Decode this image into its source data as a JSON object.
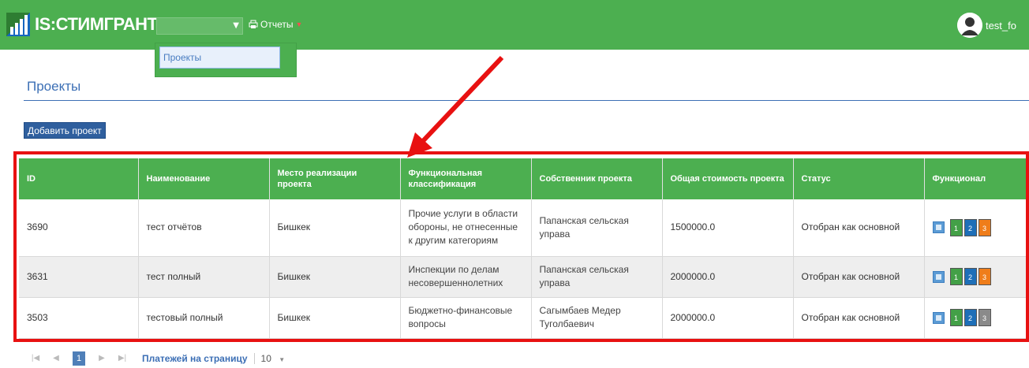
{
  "header": {
    "brand": "IS:СТИМГРАНТ",
    "reports_label": "Отчеты",
    "username": "test_fo",
    "colors": {
      "navbar": "#4caf50",
      "accent": "#3c6fb5"
    }
  },
  "dropdown": {
    "items": [
      {
        "label": "Проекты"
      }
    ]
  },
  "page": {
    "title": "Проекты",
    "add_button": "Добавить проект"
  },
  "table": {
    "columns": [
      "ID",
      "Наименование",
      "Место реализации проекта",
      "Функциональная классификация",
      "Собственник проекта",
      "Общая стоимость проекта",
      "Статус",
      "Функционал"
    ],
    "rows": [
      {
        "id": "3690",
        "name": "тест отчётов",
        "place": "Бишкек",
        "classification": "Прочие услуги в области обороны, не отнесенные к другим категориям",
        "owner": "Папанская сельская управа",
        "cost": "1500000.0",
        "status": "Отобран как основной",
        "docs": [
          "1",
          "2",
          "3"
        ]
      },
      {
        "id": "3631",
        "name": "тест полный",
        "place": "Бишкек",
        "classification": "Инспекции по делам несовершеннолетних",
        "owner": "Папанская сельская управа",
        "cost": "2000000.0",
        "status": "Отобран как основной",
        "docs": [
          "1",
          "2",
          "3"
        ]
      },
      {
        "id": "3503",
        "name": "тестовый полный",
        "place": "Бишкек",
        "classification": "Бюджетно-финансовые вопросы",
        "owner": "Сагымбаев Медер Туголбаевич",
        "cost": "2000000.0",
        "status": "Отобран как основной",
        "docs": [
          "1",
          "2",
          "3"
        ]
      }
    ],
    "doc_colors": {
      "r0": [
        "#43a047",
        "#1e6fb8",
        "#ef7d1a"
      ],
      "r1": [
        "#43a047",
        "#1e6fb8",
        "#ef7d1a"
      ],
      "r2": [
        "#43a047",
        "#1e6fb8",
        "#8a8a8a"
      ]
    }
  },
  "pagination": {
    "first": "|◀",
    "prev": "◀",
    "current_page": "1",
    "next": "▶",
    "last": "▶|",
    "per_page_label": "Платежей на страницу",
    "per_page_value": "10"
  },
  "icons": {
    "logo": "chart-bars-icon",
    "reports": "print-icon",
    "avatar": "user-avatar-icon",
    "edit": "edit-icon",
    "doc": "document-icon"
  }
}
